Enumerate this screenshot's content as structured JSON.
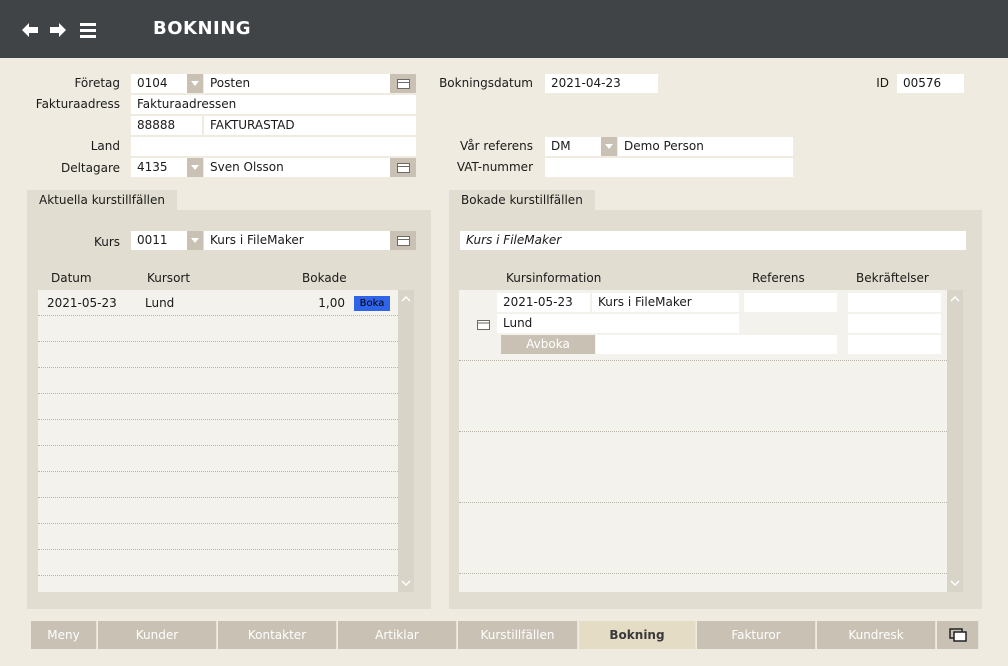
{
  "header": {
    "title": "BOKNING"
  },
  "form": {
    "foretag_label": "Företag",
    "foretag_code": "0104",
    "foretag_name": "Posten",
    "fakturaadress_label": "Fakturaadress",
    "fakturaadress": "Fakturaadressen",
    "postnr": "88888",
    "ort": "FAKTURASTAD",
    "land_label": "Land",
    "land": "",
    "deltagare_label": "Deltagare",
    "deltagare_code": "4135",
    "deltagare_name": "Sven Olsson",
    "bokningsdatum_label": "Bokningsdatum",
    "bokningsdatum": "2021-04-23",
    "id_label": "ID",
    "id": "00576",
    "var_referens_label": "Vår referens",
    "var_referens_code": "DM",
    "var_referens_name": "Demo Person",
    "vat_label": "VAT-nummer",
    "vat": ""
  },
  "left_panel": {
    "tab": "Aktuella kurstillfällen",
    "kurs_label": "Kurs",
    "kurs_code": "0011",
    "kurs_name": "Kurs i FileMaker",
    "col_datum": "Datum",
    "col_kursort": "Kursort",
    "col_bokade": "Bokade",
    "rows": [
      {
        "datum": "2021-05-23",
        "kursort": "Lund",
        "bokade": "1,00",
        "button": "Boka"
      }
    ]
  },
  "right_panel": {
    "tab": "Bokade kurstillfällen",
    "kurs_title": "Kurs i FileMaker",
    "col_kursinformation": "Kursinformation",
    "col_referens": "Referens",
    "col_bekraftelser": "Bekräftelser",
    "booking": {
      "datum": "2021-05-23",
      "kurs": "Kurs i FileMaker",
      "ort": "Lund",
      "avboka": "Avboka"
    }
  },
  "bottom_tabs": [
    {
      "label": "Meny"
    },
    {
      "label": "Kunder"
    },
    {
      "label": "Kontakter"
    },
    {
      "label": "Artiklar"
    },
    {
      "label": "Kurstillfällen"
    },
    {
      "label": "Bokning"
    },
    {
      "label": "Fakturor"
    },
    {
      "label": "Kundresk"
    }
  ],
  "colors": {
    "header": "#414446",
    "background": "#efebe0",
    "panel": "#e2ddd1",
    "button": "#c8c1b4",
    "boka": "#2f63e8"
  },
  "icons": [
    "back-arrow-icon",
    "forward-arrow-icon",
    "menu-icon",
    "card-icon",
    "chevron-down-icon",
    "window-icon"
  ]
}
